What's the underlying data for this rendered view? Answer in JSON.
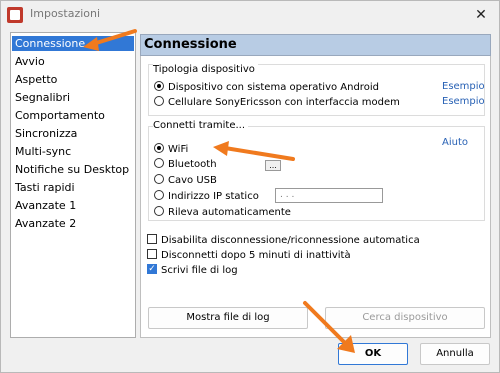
{
  "window": {
    "title": "Impostazioni",
    "close_glyph": "✕"
  },
  "sidebar": {
    "items": [
      {
        "label": "Connessione",
        "selected": true
      },
      {
        "label": "Avvio"
      },
      {
        "label": "Aspetto"
      },
      {
        "label": "Segnalibri"
      },
      {
        "label": "Comportamento"
      },
      {
        "label": "Sincronizza"
      },
      {
        "label": "Multi-sync"
      },
      {
        "label": "Notifiche su Desktop"
      },
      {
        "label": "Tasti rapidi"
      },
      {
        "label": "Avanzate 1"
      },
      {
        "label": "Avanzate 2"
      }
    ]
  },
  "panel": {
    "title": "Connessione",
    "device_type": {
      "label": "Tipologia dispositivo",
      "options": [
        {
          "label": "Dispositivo con sistema operativo Android",
          "link": "Esempio",
          "checked": true
        },
        {
          "label": "Cellulare SonyEricsson con interfaccia modem",
          "link": "Esempio",
          "checked": false
        }
      ]
    },
    "connect_via": {
      "label": "Connetti tramite...",
      "help_link": "Aiuto",
      "options": [
        {
          "label": "WiFi",
          "checked": true
        },
        {
          "label": "Bluetooth",
          "checked": false
        },
        {
          "label": "Cavo USB",
          "checked": false
        },
        {
          "label": "Indirizzo IP statico",
          "checked": false
        },
        {
          "label": "Rileva automaticamente",
          "checked": false
        }
      ],
      "bluetooth_button": "...",
      "ip_value": "  .   .   ."
    },
    "options": [
      {
        "label": "Disabilita disconnessione/riconnessione automatica",
        "checked": false
      },
      {
        "label": "Disconnetti dopo 5 minuti di inattività",
        "checked": false
      },
      {
        "label": "Scrivi file di log",
        "checked": true
      }
    ],
    "buttons": {
      "show_log": "Mostra file di log",
      "find_device": "Cerca dispositivo"
    }
  },
  "footer": {
    "ok": "OK",
    "cancel": "Annulla"
  },
  "colors": {
    "accent": "#3178d6",
    "header_bg": "#b8cce4",
    "link": "#2962b5",
    "annotation_arrow": "#f07a1e"
  }
}
